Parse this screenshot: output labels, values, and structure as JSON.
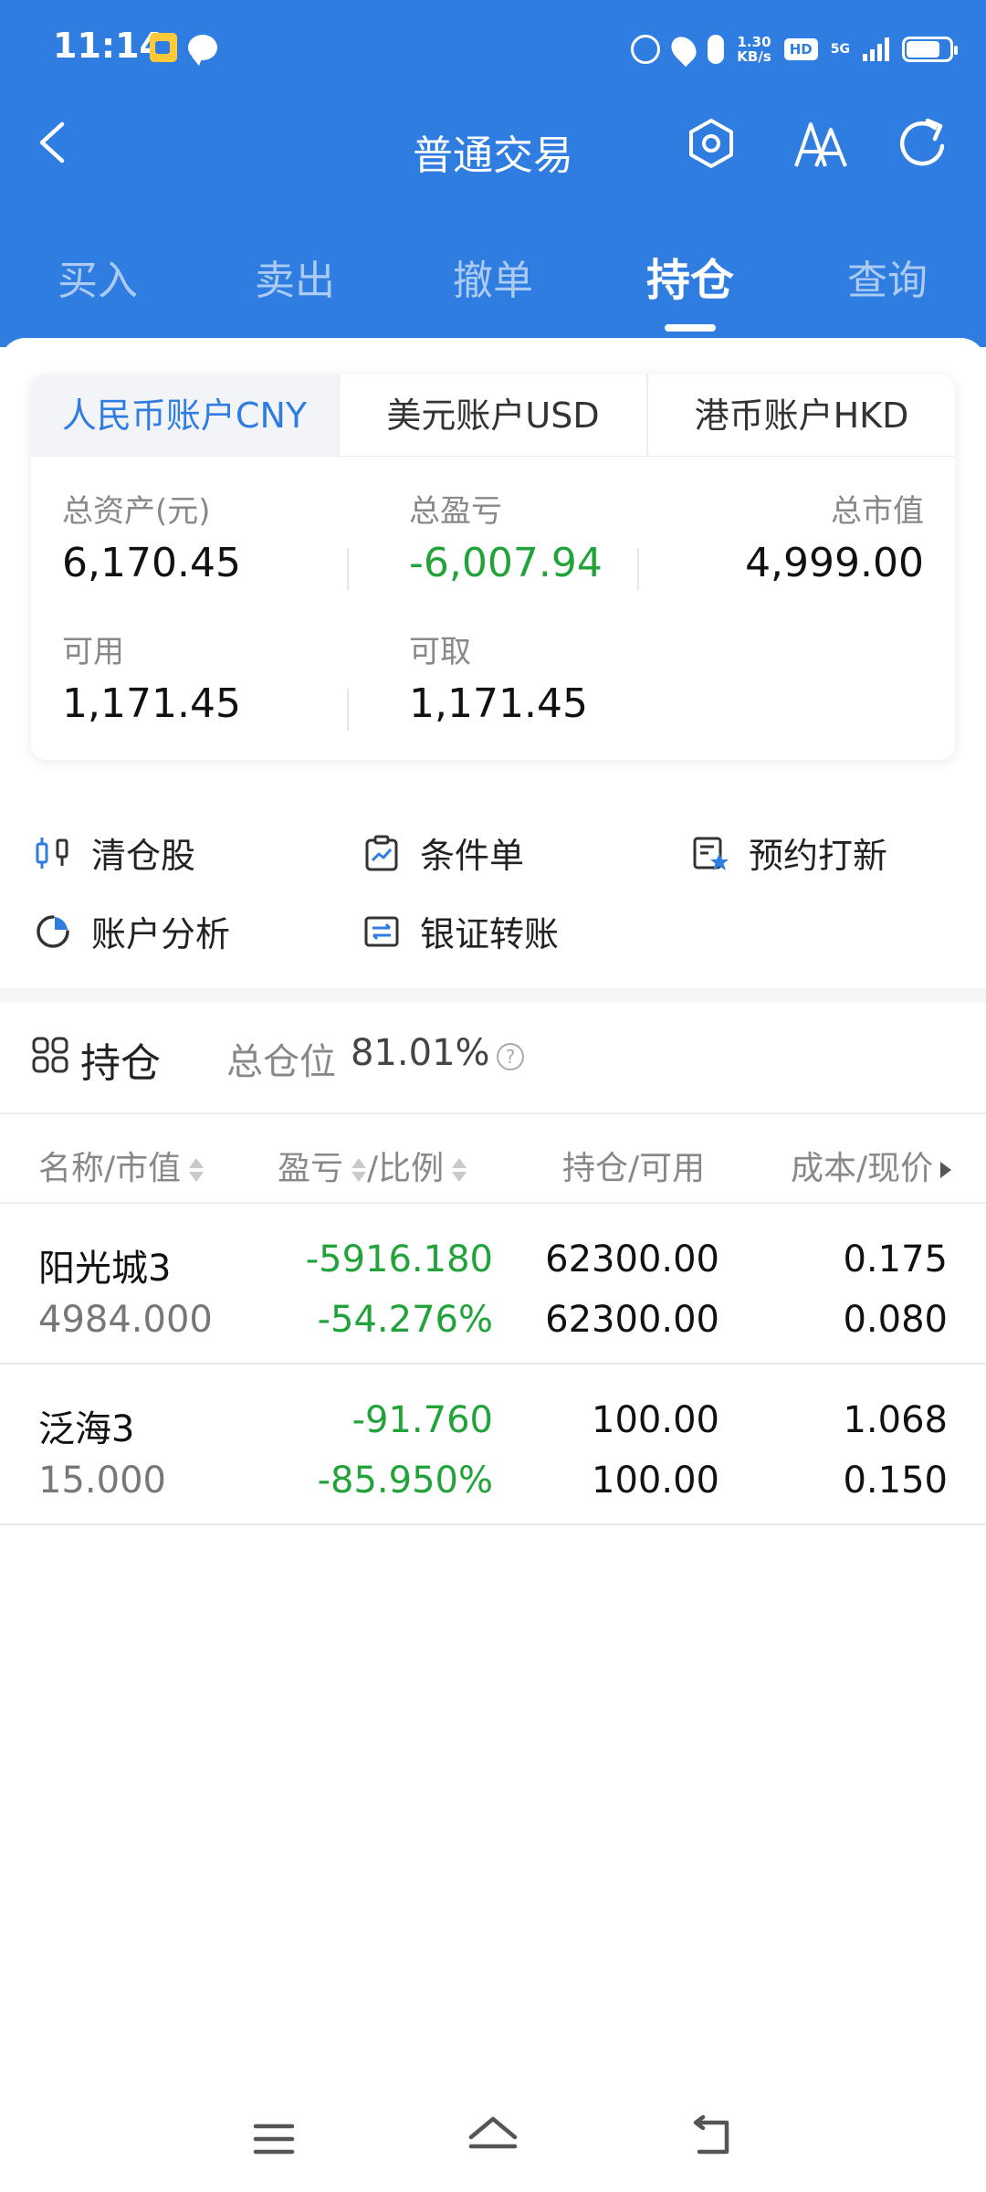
{
  "status_bar": {
    "time": "11:14",
    "speed_top": "1.30",
    "speed_bottom": "KB/s",
    "hd": "HD",
    "network": "5G"
  },
  "titlebar": {
    "title": "普通交易",
    "icons": [
      "back-icon",
      "hexagon-settings-icon",
      "font-size-icon",
      "refresh-icon"
    ]
  },
  "tabs": [
    {
      "label": "买入"
    },
    {
      "label": "卖出"
    },
    {
      "label": "撤单"
    },
    {
      "label": "持仓",
      "active": true
    },
    {
      "label": "查询"
    }
  ],
  "account_tabs": [
    {
      "label": "人民币账户CNY",
      "active": true
    },
    {
      "label": "美元账户USD"
    },
    {
      "label": "港币账户HKD"
    }
  ],
  "summary": {
    "total_assets_label": "总资产(元)",
    "total_assets": "6,170.45",
    "total_pnl_label": "总盈亏",
    "total_pnl": "-6,007.94",
    "market_value_label": "总市值",
    "market_value": "4,999.00",
    "available_label": "可用",
    "available": "1,171.45",
    "withdrawable_label": "可取",
    "withdrawable": "1,171.45"
  },
  "quick_actions": [
    {
      "label": "清仓股",
      "icon": "candlestick-icon"
    },
    {
      "label": "条件单",
      "icon": "clipboard-chart-icon"
    },
    {
      "label": "预约打新",
      "icon": "calendar-star-icon"
    },
    {
      "label": "账户分析",
      "icon": "pie-chart-icon"
    },
    {
      "label": "银证转账",
      "icon": "transfer-icon"
    }
  ],
  "holdings": {
    "title": "持仓",
    "position_label": "总仓位",
    "position_value": "81.01%",
    "help": "?",
    "columns": [
      "名称/市值",
      "盈亏",
      "/比例",
      "持仓/可用",
      "成本/现价"
    ],
    "rows": [
      {
        "name": "阳光城3",
        "market_value": "4984.000",
        "pnl": "-5916.180",
        "pnl_ratio": "-54.276%",
        "holding": "62300.00",
        "available": "62300.00",
        "cost": "0.175",
        "price": "0.080"
      },
      {
        "name": "泛海3",
        "market_value": "15.000",
        "pnl": "-91.760",
        "pnl_ratio": "-85.950%",
        "holding": "100.00",
        "available": "100.00",
        "cost": "1.068",
        "price": "0.150"
      }
    ]
  },
  "colors": {
    "brand_blue": "#2f7de1",
    "loss_green": "#22a33a"
  }
}
